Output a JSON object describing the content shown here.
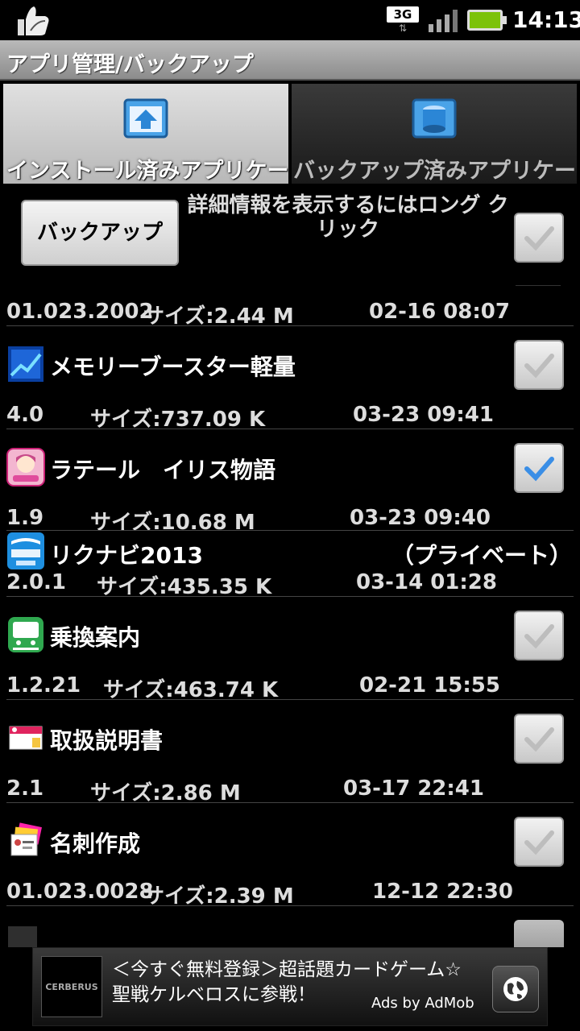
{
  "status": {
    "network": "3G",
    "network_arrows": "⇅",
    "time": "14:13"
  },
  "title": "アプリ管理/バックアップ",
  "tabs": [
    {
      "label": "インストール済みアプリケー",
      "icon": "install-app-icon",
      "active": true
    },
    {
      "label": "バックアップ済みアプリケー",
      "icon": "backup-database-icon",
      "active": false
    }
  ],
  "toolbar": {
    "backup_label": "バックアップ",
    "hint": "詳細情報を表示するにはロング クリック"
  },
  "first_meta": {
    "version": "01.023.2002",
    "size": "サイズ:2.44 M",
    "date": "02-16 08:07"
  },
  "apps": [
    {
      "name": "メモリーブースター軽量",
      "icon": "chart-trend-icon",
      "version": "4.0",
      "size": "サイズ:737.09 K",
      "date": "03-23 09:41",
      "checked": false
    },
    {
      "name": "ラテール　イリス物語",
      "icon": "anime-character-icon",
      "version": "1.9",
      "size": "サイズ:10.68 M",
      "date": "03-23 09:40",
      "checked": true
    },
    {
      "name": "リクナビ2013",
      "icon": "rikunabi-icon",
      "version": "2.0.1",
      "size": "サイズ:435.35 K",
      "date": "03-14 01:28",
      "private": "（プライベート）"
    },
    {
      "name": "乗換案内",
      "icon": "train-icon",
      "version": "1.2.21",
      "size": "サイズ:463.74 K",
      "date": "02-21 15:55",
      "checked": false
    },
    {
      "name": "取扱説明書",
      "icon": "manual-icon",
      "version": "2.1",
      "size": "サイズ:2.86 M",
      "date": "03-17 22:41",
      "checked": false
    },
    {
      "name": "名刺作成",
      "icon": "business-card-icon",
      "version": "01.023.0028",
      "size": "サイズ:2.39 M",
      "date": "12-12 22:30",
      "checked": false
    }
  ],
  "ad": {
    "text": "＜今すぐ無料登録＞超話題カードゲーム☆聖戦ケルベロスに参戦！",
    "by": "Ads by AdMob",
    "logo_text": "CERBERUS"
  },
  "colors": {
    "accent_check": "#3a8ee6",
    "battery": "#7cc20a"
  }
}
